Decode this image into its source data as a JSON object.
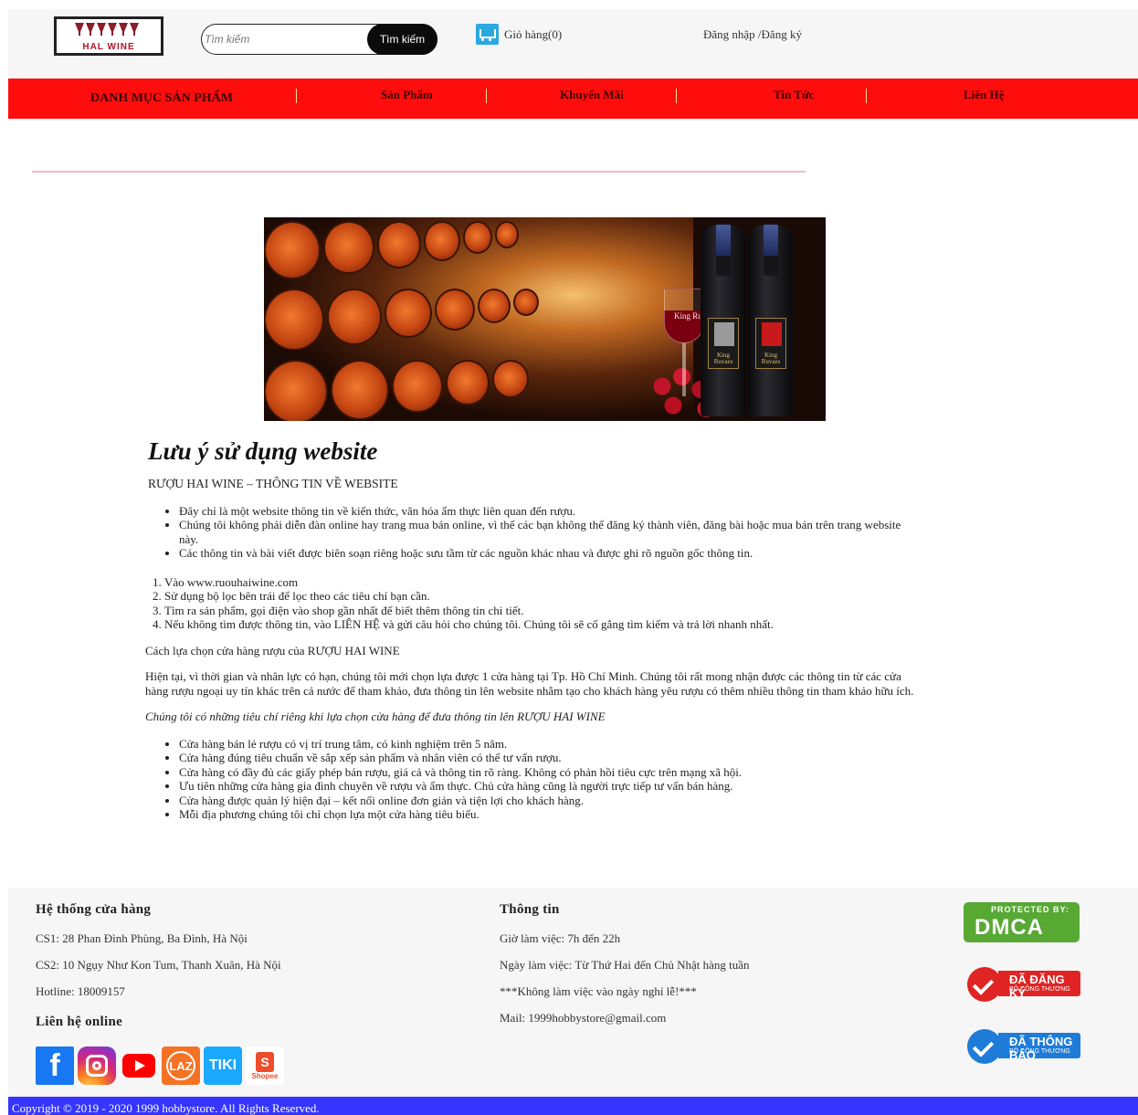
{
  "header": {
    "logo_text": "HAL WINE",
    "search_placeholder": "Tìm kiếm",
    "search_button": "Tìm kiếm",
    "cart_label": "Giỏ hàng(0)",
    "login_label": "Đăng nhập /Đăng ký"
  },
  "nav": {
    "category": "DANH MỤC SẢN PHẨM",
    "items": [
      "Sản Phẩm",
      "Khuyến Mãi",
      "Tin Tức",
      "Liên Hệ"
    ]
  },
  "banner": {
    "bottle_brand_1": "King Ruvaes",
    "bottle_brand_2": "King Ruvaes",
    "glass_brand": "King Ruvaes"
  },
  "article": {
    "title": "Lưu ý sử dụng website",
    "subhead": "RƯỢU HAI WINE – THÔNG TIN VỀ WEBSITE",
    "notes": [
      "Đây chỉ là một website thông tin về kiến thức, văn hóa ẩm thực liên quan đến rượu.",
      "Chúng tôi không phải diễn đàn online hay trang mua bán online, vì thế các bạn không thể đăng ký thành viên, đăng bài hoặc mua bán trên trang website này.",
      "Các thông tin và bài viết được biên soạn riêng hoặc sưu tầm từ các nguồn khác nhau và được ghi rõ nguồn gốc thông tin."
    ],
    "steps": [
      "Vào www.ruouhaiwine.com",
      "Sử dụng bộ lọc bên trái để lọc theo các tiêu chí bạn cần.",
      "Tìm ra sản phẩm, gọi điện vào shop gần nhất để biết thêm thông tin chi tiết.",
      "Nếu không tìm được thông tin, vào LIÊN HỆ và gửi câu hỏi cho chúng tôi. Chúng tôi sẽ cố gắng tìm kiếm và trả lời nhanh nhất."
    ],
    "para_choose": "Cách lựa chọn cửa hàng rượu của RƯỢU HAI WINE",
    "para_current": "Hiện tại, vì thời gian và nhân lực có hạn, chúng tôi mới chọn lựa được 1 cửa hàng tại Tp. Hồ Chí Minh. Chúng tôi rất mong nhận được các thông tin từ các cửa hàng rượu ngoại uy tín khác trên cả nước để tham khảo, đưa thông tin lên website nhằm tạo cho khách hàng yêu rượu có thêm nhiều thông tin tham khảo hữu ích.",
    "para_criteria": "Chúng tôi có những tiêu chí riêng khi lựa chọn cửa hàng để đưa thông tin lên RƯỢU HAI WINE",
    "criteria": [
      "Cửa hàng bán lẻ rượu có vị trí trung tâm, có kinh nghiệm trên 5 năm.",
      "Cửa hàng đúng tiêu chuẩn về sắp xếp sản phẩm và nhân viên có thể tư vấn rượu.",
      "Cửa hàng có đầy đủ các giấy phép bán rượu, giá cả và thông tin rõ ràng. Không có phản hồi tiêu cực trên mạng xã hội.",
      "Ưu tiên những cửa hàng gia đình chuyên về rượu và ẩm thực. Chủ cửa hàng cũng là người trực tiếp tư vấn bán hàng.",
      "Cửa hàng được quản lý hiện đại – kết nối online đơn giản và tiện lợi cho khách hàng.",
      "Mỗi địa phương chúng tôi chỉ chọn lựa một cửa hàng tiêu biểu."
    ]
  },
  "footer": {
    "stores_title": "Hệ thống cửa hàng",
    "store_1": "CS1: 28 Phan Đình Phùng, Ba Đình, Hà Nội",
    "store_2": "CS2: 10 Ngụy Như Kon Tum, Thanh Xuân, Hà Nội",
    "hotline": "Hotline: 18009157",
    "online_title": "Liên hệ online",
    "info_title": "Thông tin",
    "hours": "Giờ làm việc: 7h đến 22h",
    "days": "Ngày làm việc: Từ Thứ Hai đến Chủ Nhật hàng tuần",
    "holiday": "***Không làm việc vào ngày nghỉ lễ!***",
    "mail": "Mail: 1999hobbystore@gmail.com",
    "dmca_top": "PROTECTED BY:",
    "dmca_big": "DMCA",
    "reg_t1": "ĐÃ ĐĂNG KÝ",
    "reg_t2": "BỘ CÔNG THƯƠNG",
    "notif_t1": "ĐÃ THÔNG BÁO",
    "notif_t2": "BỘ CÔNG THƯƠNG",
    "social_laz": "LAZ",
    "social_tiki": "TIKI",
    "social_shopee_bag": "S",
    "social_shopee": "Shopee",
    "social_fb": "f",
    "copyright": "Copyright © 2019 - 2020 1999 hobbystore. All Rights Reserved."
  },
  "colors": {
    "nav_bg": "#ff0d0d",
    "copyright_bg": "#3535ff",
    "footer_bg": "#f6f6f6"
  }
}
